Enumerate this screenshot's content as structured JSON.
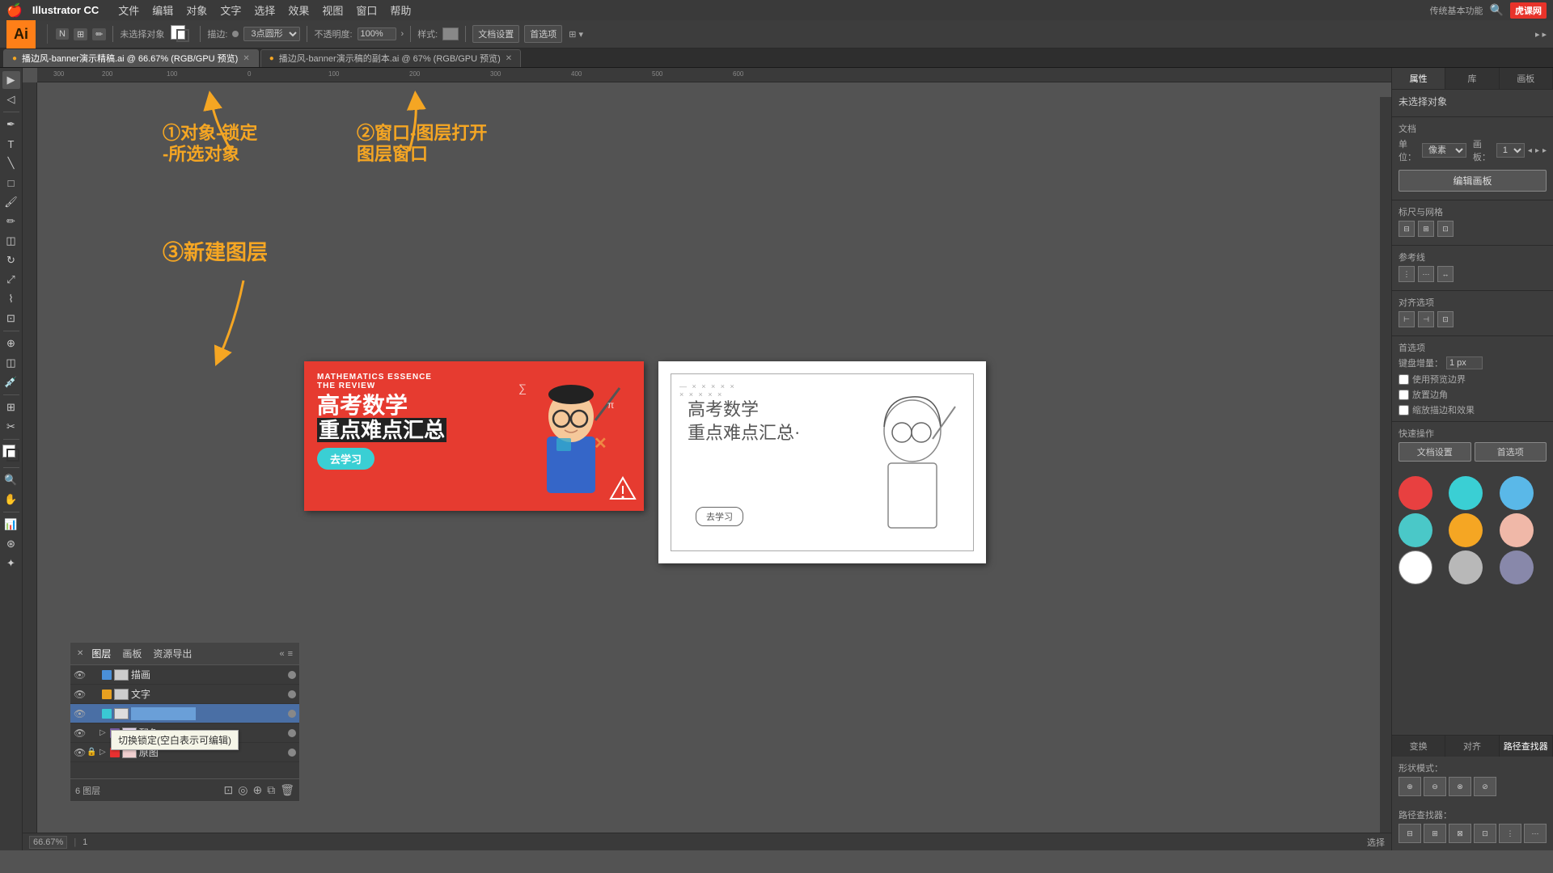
{
  "app": {
    "name": "Illustrator CC",
    "ai_text": "Ai"
  },
  "menu": {
    "apple": "🍎",
    "app_name": "Illustrator CC",
    "items": [
      "文件",
      "编辑",
      "对象",
      "文字",
      "选择",
      "效果",
      "视图",
      "窗口",
      "帮助"
    ]
  },
  "toolbar": {
    "no_select": "未选择对象",
    "stroke_label": "描边:",
    "stroke_value": "3点圆形",
    "opacity_label": "不透明度:",
    "opacity_value": "100%",
    "style_label": "样式:",
    "doc_settings": "文档设置",
    "preferences": "首选项"
  },
  "tabs": [
    {
      "label": "播边风-banner演示精稿.ai @ 66.67% (RGB/GPU 预览)",
      "active": true
    },
    {
      "label": "播边风-banner演示稿的副本.ai @ 67% (RGB/GPU 预览)",
      "active": false
    }
  ],
  "annotations": {
    "step1": "①对象-锁定",
    "step1b": "-所选对象",
    "step2": "②窗口-图层打开",
    "step2b": "图层窗口",
    "step3": "③新建图层"
  },
  "layers_panel": {
    "tabs": [
      "图层",
      "画板",
      "资源导出"
    ],
    "layers": [
      {
        "name": "描画",
        "color": "#4a90d9",
        "visible": true,
        "locked": false,
        "selected": false
      },
      {
        "name": "文字",
        "color": "#e8a020",
        "visible": true,
        "locked": false,
        "selected": false
      },
      {
        "name": "",
        "color": "#3ac8d4",
        "visible": true,
        "locked": false,
        "selected": true,
        "editing": true
      },
      {
        "name": "配色",
        "color": "#7b5ea7",
        "visible": true,
        "locked": false,
        "selected": false,
        "expanded": true
      },
      {
        "name": "原图",
        "color": "#e83030",
        "visible": true,
        "locked": true,
        "selected": false
      }
    ],
    "count": "6 图层",
    "tooltip": "切换锁定(空白表示可编辑)"
  },
  "right_panel": {
    "tabs": [
      "属性",
      "库",
      "画板"
    ],
    "no_selection": "未选择对象",
    "doc_section": {
      "label": "文档",
      "unit_label": "单位：",
      "unit_value": "像素",
      "artboard_label": "画板：",
      "artboard_value": "1"
    },
    "edit_template": "编辑画板",
    "swatches": [
      {
        "color": "#e84040",
        "label": "red"
      },
      {
        "color": "#3acfd4",
        "label": "teal"
      },
      {
        "color": "#5ab8e8",
        "label": "blue"
      },
      {
        "color": "#4ac8c8",
        "label": "cyan"
      },
      {
        "color": "#f5a623",
        "label": "orange"
      },
      {
        "color": "#f0b8a8",
        "label": "peach"
      },
      {
        "color": "#ffffff",
        "label": "white"
      },
      {
        "color": "#b8b8b8",
        "label": "gray"
      },
      {
        "color": "#8888aa",
        "label": "lavender"
      }
    ],
    "align_section": {
      "label": "标尺与网格"
    },
    "oppose_label": "对齐选项",
    "first_label": "首选项",
    "keyboard_nudge": "键盘增量：",
    "nudge_value": "1 px",
    "use_preview": "使用预览边界",
    "round_corners": "放置边角",
    "anti_alias": "缩放描边和效果",
    "quick_actions": {
      "label": "快速操作",
      "doc_settings": "文档设置",
      "preferences": "首选项"
    },
    "bottom_tabs": [
      "变换",
      "对齐",
      "路径查找器"
    ],
    "shape_modes": {
      "label": "形状模式："
    },
    "pathfinder": {
      "label": "路径查找器："
    }
  },
  "status_bar": {
    "zoom": "66.67%",
    "artboard": "1",
    "tool": "选择"
  },
  "banner": {
    "top_line1": "MATHEMATICS ESSENCE",
    "top_line2": "THE REVIEW",
    "main_title1": "高考数学",
    "main_title2": "重点难点汇总",
    "button": "去学习"
  },
  "sketch": {
    "text1": "高考数学",
    "text2": "重点难点汇总·",
    "button": "去学习"
  },
  "huke": {
    "logo": "虎课网",
    "function": "传统基本功能"
  }
}
